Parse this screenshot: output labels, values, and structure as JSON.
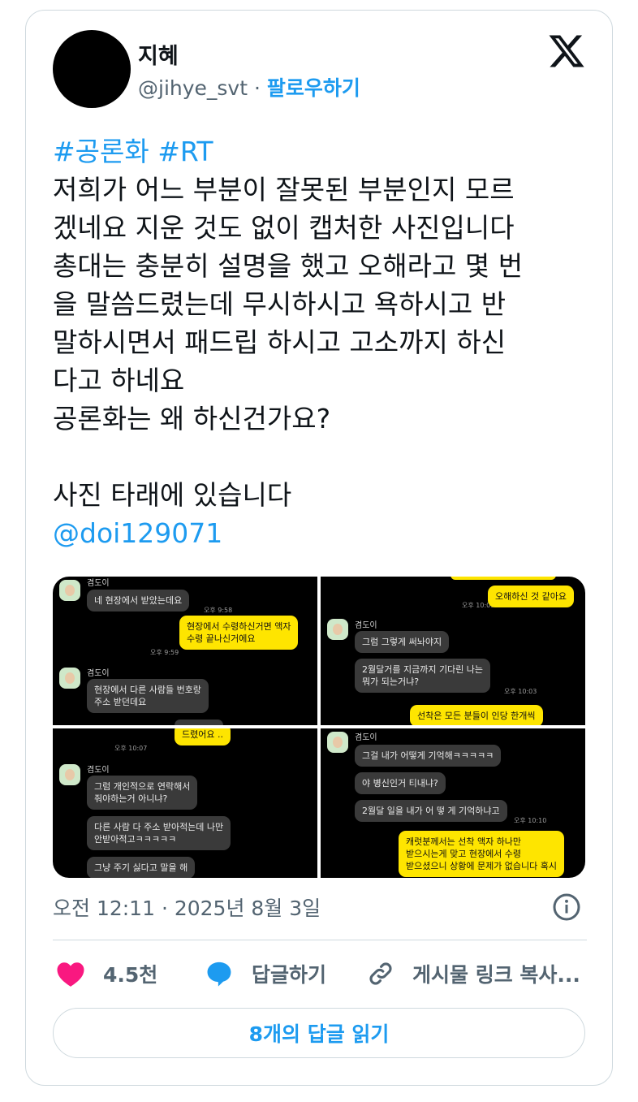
{
  "author": {
    "name": "지혜",
    "handle": "@jihye_svt",
    "separator": "·",
    "follow_label": "팔로우하기"
  },
  "icons": {
    "platform": "x-logo-icon",
    "info": "info-icon",
    "like": "heart-icon",
    "reply": "speech-bubble-icon",
    "copy": "link-icon"
  },
  "tweet": {
    "hashtags": "#공론화 #RT",
    "lines": [
      "저희가 어느 부분이 잘못된 부분인지 모르",
      "겠네요 지운 것도 없이 캡처한 사진입니다",
      "총대는 충분히 설명을 했고 오해라고 몇 번",
      "을 말씀드렸는데 무시하시고 욕하시고 반",
      "말하시면서 패드립 하시고 고소까지 하신",
      "다고 하네요",
      "공론화는 왜 하신건가요?"
    ],
    "photo_line": "사진 타래에 있습니다",
    "mention": "@doi129071"
  },
  "screenshots": {
    "s1": {
      "sender_top": "겸도이",
      "msg1": "네 현장에서 받았는데요",
      "time1": "오후 9:58",
      "msg2_l1": "현장에서 수령하신거면 액자",
      "msg2_l2": "수령 끝나신거에요",
      "time2": "오후 9:59",
      "sender2": "겸도이",
      "msg3_l1": "현장에서 다른 사람들 번호랑",
      "msg3_l2": "주소 받던데요"
    },
    "s2": {
      "time1": "오후 10:03",
      "msg1": "오해하신 것 같아요",
      "sender": "겸도이",
      "msg2": "그럼 그렇게 써놔야지",
      "msg3_l1": "2월달거를 지금까지 기다린 나는",
      "msg3_l2": "뭐가 되는거냐?",
      "time2": "오후 10:03",
      "msg4": "선착은 모든 분들이 인당 한개씩"
    },
    "s3": {
      "msg0": "드렸어요 ..",
      "time0": "오후 10:07",
      "sender": "겸도이",
      "msg1_l1": "그럼 개인적으로 연락해서",
      "msg1_l2": "줘야하는거 아니냐?",
      "msg2_l1": "다른 사람 다 주소 받아적는데 나만",
      "msg2_l2": "안받아적고ㅋㅋㅋㅋㅋ",
      "msg3": "그냥 주기 싫다고 말을 해"
    },
    "s4": {
      "sender": "겸도이",
      "msg1": "그걸 내가 어떻게 기억해ㅋㅋㅋㅋㅋ",
      "msg2": "야 병신인거 티내냐?",
      "msg3": "2월달 일을 내가 어 떻 게 기억하냐고",
      "time1": "오후 10:10",
      "msg4_l1": "캐럿분께서는 선착 액자 하나만",
      "msg4_l2": "받으시는게 맞고 현장에서 수령",
      "msg4_l3": "받으셨으니 상황에 문제가 없습니다 혹시"
    }
  },
  "meta": {
    "timestamp": "오전 12:11 · 2025년 8월 3일"
  },
  "actions": {
    "like_count": "4.5천",
    "reply_label": "답글하기",
    "copy_label": "게시물 링크 복사..."
  },
  "read_replies_label": "8개의 답글 읽기",
  "colors": {
    "accent": "#1d9bf0",
    "like": "#f91880",
    "kakao_yellow": "#fee500"
  }
}
